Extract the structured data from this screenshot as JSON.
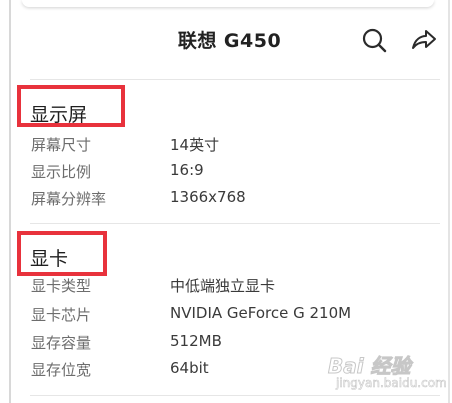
{
  "header": {
    "title": "联想 G450",
    "search_icon": "search-icon",
    "share_icon": "share-icon"
  },
  "sections": [
    {
      "title": "显示屏",
      "rows": [
        {
          "label": "屏幕尺寸",
          "value": "14英寸"
        },
        {
          "label": "显示比例",
          "value": "16:9"
        },
        {
          "label": "屏幕分辨率",
          "value": "1366x768"
        }
      ]
    },
    {
      "title": "显卡",
      "rows": [
        {
          "label": "显卡类型",
          "value": "中低端独立显卡"
        },
        {
          "label": "显卡芯片",
          "value": "NVIDIA GeForce G 210M"
        },
        {
          "label": "显存容量",
          "value": "512MB"
        },
        {
          "label": "显存位宽",
          "value": "64bit"
        }
      ]
    }
  ],
  "watermark": {
    "text": "Bai 经验",
    "url": "jingyan.baidu.com"
  },
  "colors": {
    "highlight": "#e8323c",
    "text_primary": "#222222",
    "text_label": "#6d6d6d"
  }
}
